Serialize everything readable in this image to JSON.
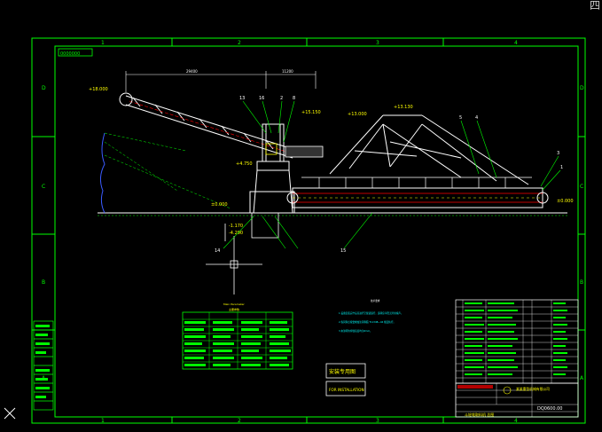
{
  "viewport": {
    "corner_label": "四"
  },
  "frame": {
    "columns": [
      "1",
      "2",
      "3",
      "4"
    ],
    "rows": [
      "D",
      "C",
      "B",
      "A"
    ],
    "title_tag": "0000000"
  },
  "elevations": {
    "top_left": "+18.000",
    "upper_mid": "+13.000",
    "upper_right": "+13.130",
    "right_mid": "+15.150",
    "left_mid": "+4.750",
    "ground_left": "±0.000",
    "ground_right": "±0.000",
    "below_1": "-1.170",
    "below_2": "-4.290"
  },
  "dimensions": {
    "top_1": "29400",
    "top_2": "11200"
  },
  "callouts": {
    "items": [
      "1",
      "2",
      "3",
      "4",
      "5",
      "8",
      "13",
      "14",
      "15",
      "16"
    ]
  },
  "tech_notes": {
    "title": "技术要求",
    "line1": "1.设备安装完毕后应进行空载试运行，运转应平稳无异常噪声。",
    "line2": "2.各润滑点按要求加注润滑脂 T1134B—94 规定执行。",
    "line3": "3.未注明的焊缝高度均为6mm。"
  },
  "param_table": {
    "title": "Main Parameter",
    "subtitle": "主要参数"
  },
  "stamps": {
    "top": "安装专用图",
    "bottom": "FOR INSTALLATION"
  },
  "title_block": {
    "company": "某某重型机械有限公司",
    "drawing_no": "DQ0600.00",
    "footer": "斗轮堆取料机 总图"
  },
  "colors": {
    "green": "#00ff00",
    "white": "#ffffff",
    "yellow": "#ffff00",
    "red": "#ff0000",
    "blue": "#3a5bff",
    "cyan": "#00ffff"
  }
}
